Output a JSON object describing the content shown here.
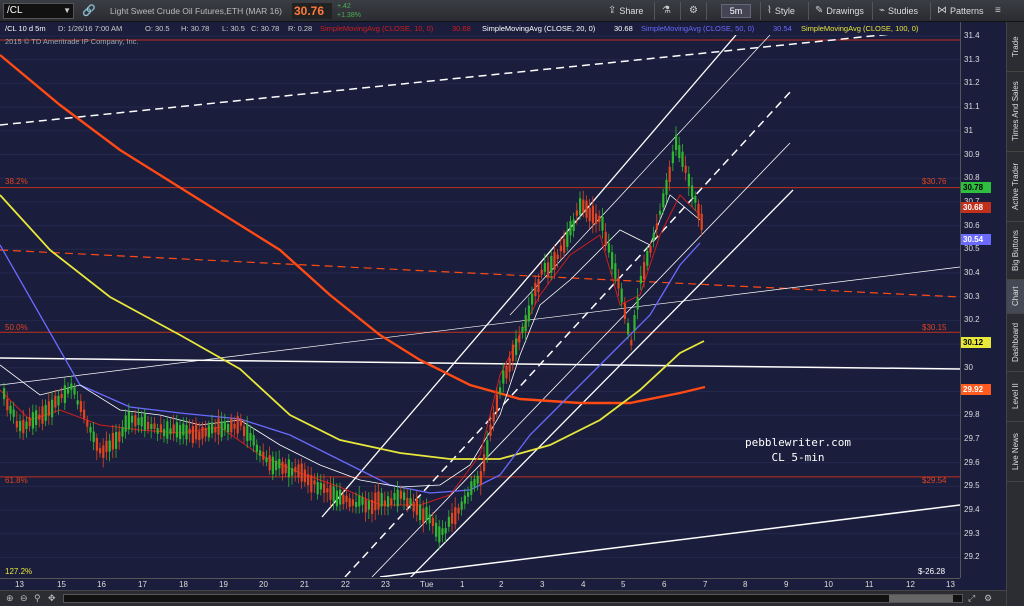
{
  "toolbar": {
    "symbol": "/CL",
    "description": "Light Sweet Crude Oil Futures,ETH (MAR 16)",
    "last_price": "30.76",
    "change": "+.42",
    "change_pct": "+1.38%",
    "share": "Share",
    "style": "Style",
    "drawings": "Drawings",
    "studies": "Studies",
    "patterns": "Patterns",
    "timeframe": "5m"
  },
  "ohlc": {
    "label": "/CL 10 d 5m",
    "date": "D: 1/26/16 7:00 AM",
    "open": "O: 30.5",
    "high": "H: 30.78",
    "low": "L: 30.5",
    "close": "C: 30.78",
    "range": "R: 0.28",
    "sma10": "SimpleMovingAvg (CLOSE, 10, 0)",
    "sma10_val": "30.68",
    "sma20": "SimpleMovingAvg (CLOSE, 20, 0)",
    "sma20_val": "30.68",
    "sma50": "SimpleMovingAvg (CLOSE, 50, 0)",
    "sma50_val": "30.54",
    "sma100": "SimpleMovingAvg (CLOSE, 100, 0)"
  },
  "copyright": "2015 © TD Ameritrade IP Company, Inc.",
  "fib": {
    "l382": "38.2%",
    "l382_val": "$30.76",
    "l50": "50.0%",
    "l50_val": "$30.15",
    "l618": "61.8%",
    "l618_val": "$29.54",
    "l1272": "127.2%",
    "l1272_val": "$-26.28"
  },
  "watermark": [
    "pebblewriter.com",
    "CL 5-min"
  ],
  "yticks": [
    "31.4",
    "31.3",
    "31.2",
    "31.1",
    "31",
    "30.9",
    "30.8",
    "30.7",
    "30.6",
    "30.5",
    "30.4",
    "30.3",
    "30.2",
    "30.1",
    "30",
    "29.9",
    "29.8",
    "29.7",
    "29.6",
    "29.5",
    "29.4",
    "29.3",
    "29.2"
  ],
  "ybadges": [
    {
      "label": "30.78",
      "bg": "#2fbf3f",
      "fg": "#000"
    },
    {
      "label": "30.68",
      "bg": "#c0301c",
      "fg": "#fff"
    },
    {
      "label": "30.54",
      "bg": "#6a6aff",
      "fg": "#fff"
    },
    {
      "label": "30.12",
      "bg": "#e8e83a",
      "fg": "#000"
    },
    {
      "label": "29.92",
      "bg": "#ff5a1f",
      "fg": "#fff"
    }
  ],
  "xticks": [
    "13",
    "15",
    "16",
    "17",
    "18",
    "19",
    "20",
    "21",
    "22",
    "23",
    "Tue",
    "1",
    "2",
    "3",
    "4",
    "5",
    "6",
    "7",
    "8",
    "9",
    "10",
    "11",
    "12",
    "13"
  ],
  "right_tabs": [
    "Trade",
    "Times And Sales",
    "Active Trader",
    "Big Buttons",
    "Chart",
    "Dashboard",
    "Level II",
    "Live News"
  ],
  "colors": {
    "bg": "#1a1d3c",
    "sma10": "#d21d1d",
    "sma20": "#ffffff",
    "sma50": "#6a6aff",
    "sma100": "#e8e83a",
    "sma200": "#ff4a14",
    "up": "#2fb82f",
    "down": "#e0451f"
  }
}
